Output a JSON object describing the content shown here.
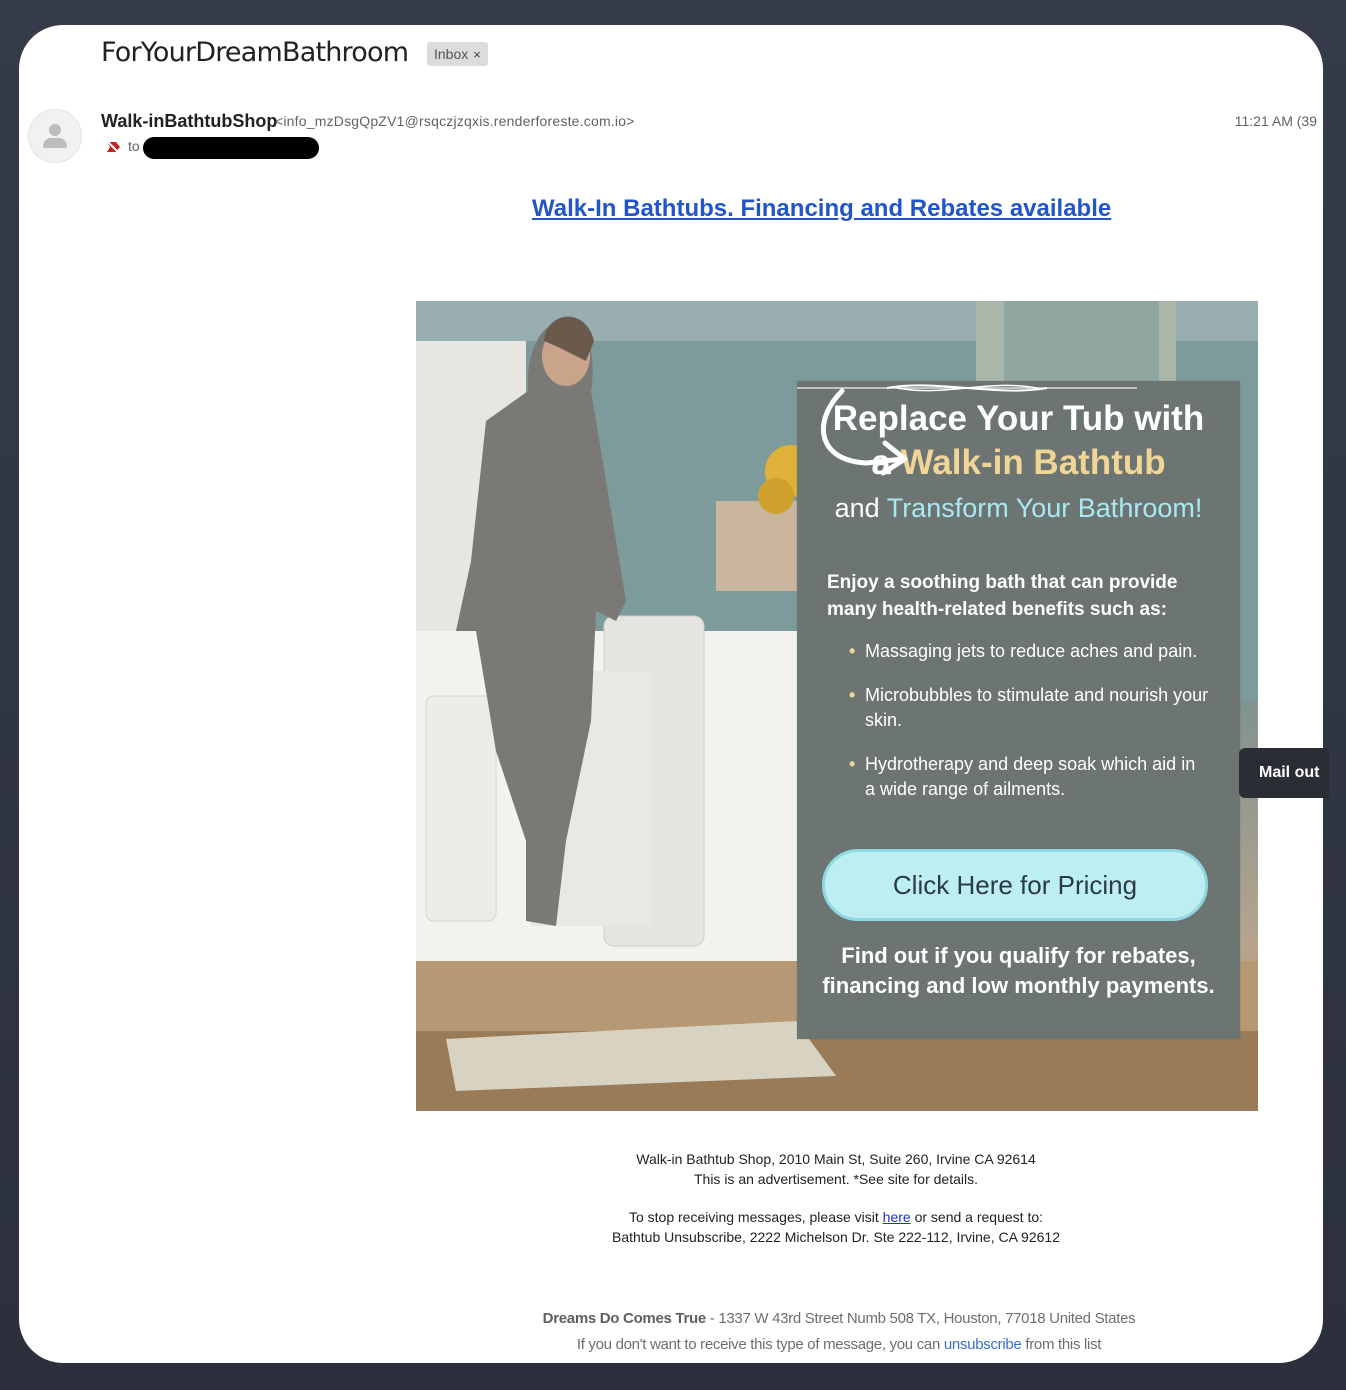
{
  "email": {
    "subject": "ForYourDreamBathroom",
    "label_chip": "Inbox",
    "label_chip_close": "×",
    "sender_name": "Walk-inBathtubShop",
    "sender_email": "<info_mzDsgQpZV1@rsqczjzqxis.renderforeste.com.io>",
    "time": "11:21 AM (39",
    "to_label": "to"
  },
  "body": {
    "headline_link": "Walk-In Bathtubs. Financing and Rebates available",
    "hero": {
      "title_line1": "Replace Your Tub with",
      "title_line2_prefix": "a ",
      "title_line2_highlight": "Walk-in Bathtub",
      "title_line3_prefix": "and ",
      "title_line3_highlight": "Transform Your Bathroom!",
      "intro": "Enjoy a soothing bath that can provide many health-related benefits such as:",
      "benefits": [
        "Massaging jets to reduce aches and pain.",
        "Microbubbles to stimulate and nourish your skin.",
        "Hydrotherapy and deep soak which aid in a wide range of ailments."
      ],
      "cta_label": "Click Here for Pricing",
      "footer_text": "Find out if you qualify for rebates, financing and low monthly payments."
    },
    "footer": {
      "address_line": "Walk-in Bathtub Shop, 2010 Main St, Suite 260, Irvine CA 92614",
      "ad_notice": "This is an advertisement. *See site for details.",
      "unsub_prefix": "To stop receiving messages, please visit ",
      "unsub_link": "here",
      "unsub_suffix": " or send a request to:",
      "unsub_address": "Bathtub Unsubscribe, 2222 Michelson Dr. Ste 222-112, Irvine, CA 92612",
      "brand": "Dreams Do Comes True",
      "brand_address": " - 1337 W 43rd Street Numb 508 TX, Houston, 77018 United States",
      "list_prefix": "If you don't want to receive this type of message, you can ",
      "list_link": "unsubscribe",
      "list_suffix": " from this list"
    }
  },
  "side_tab": "Mail out",
  "colors": {
    "link": "#2155c9",
    "overlay": "#6c7571",
    "highlight_yellow": "#f1d597",
    "highlight_cyan": "#a9e8f2",
    "cta": "#bdeef2"
  }
}
